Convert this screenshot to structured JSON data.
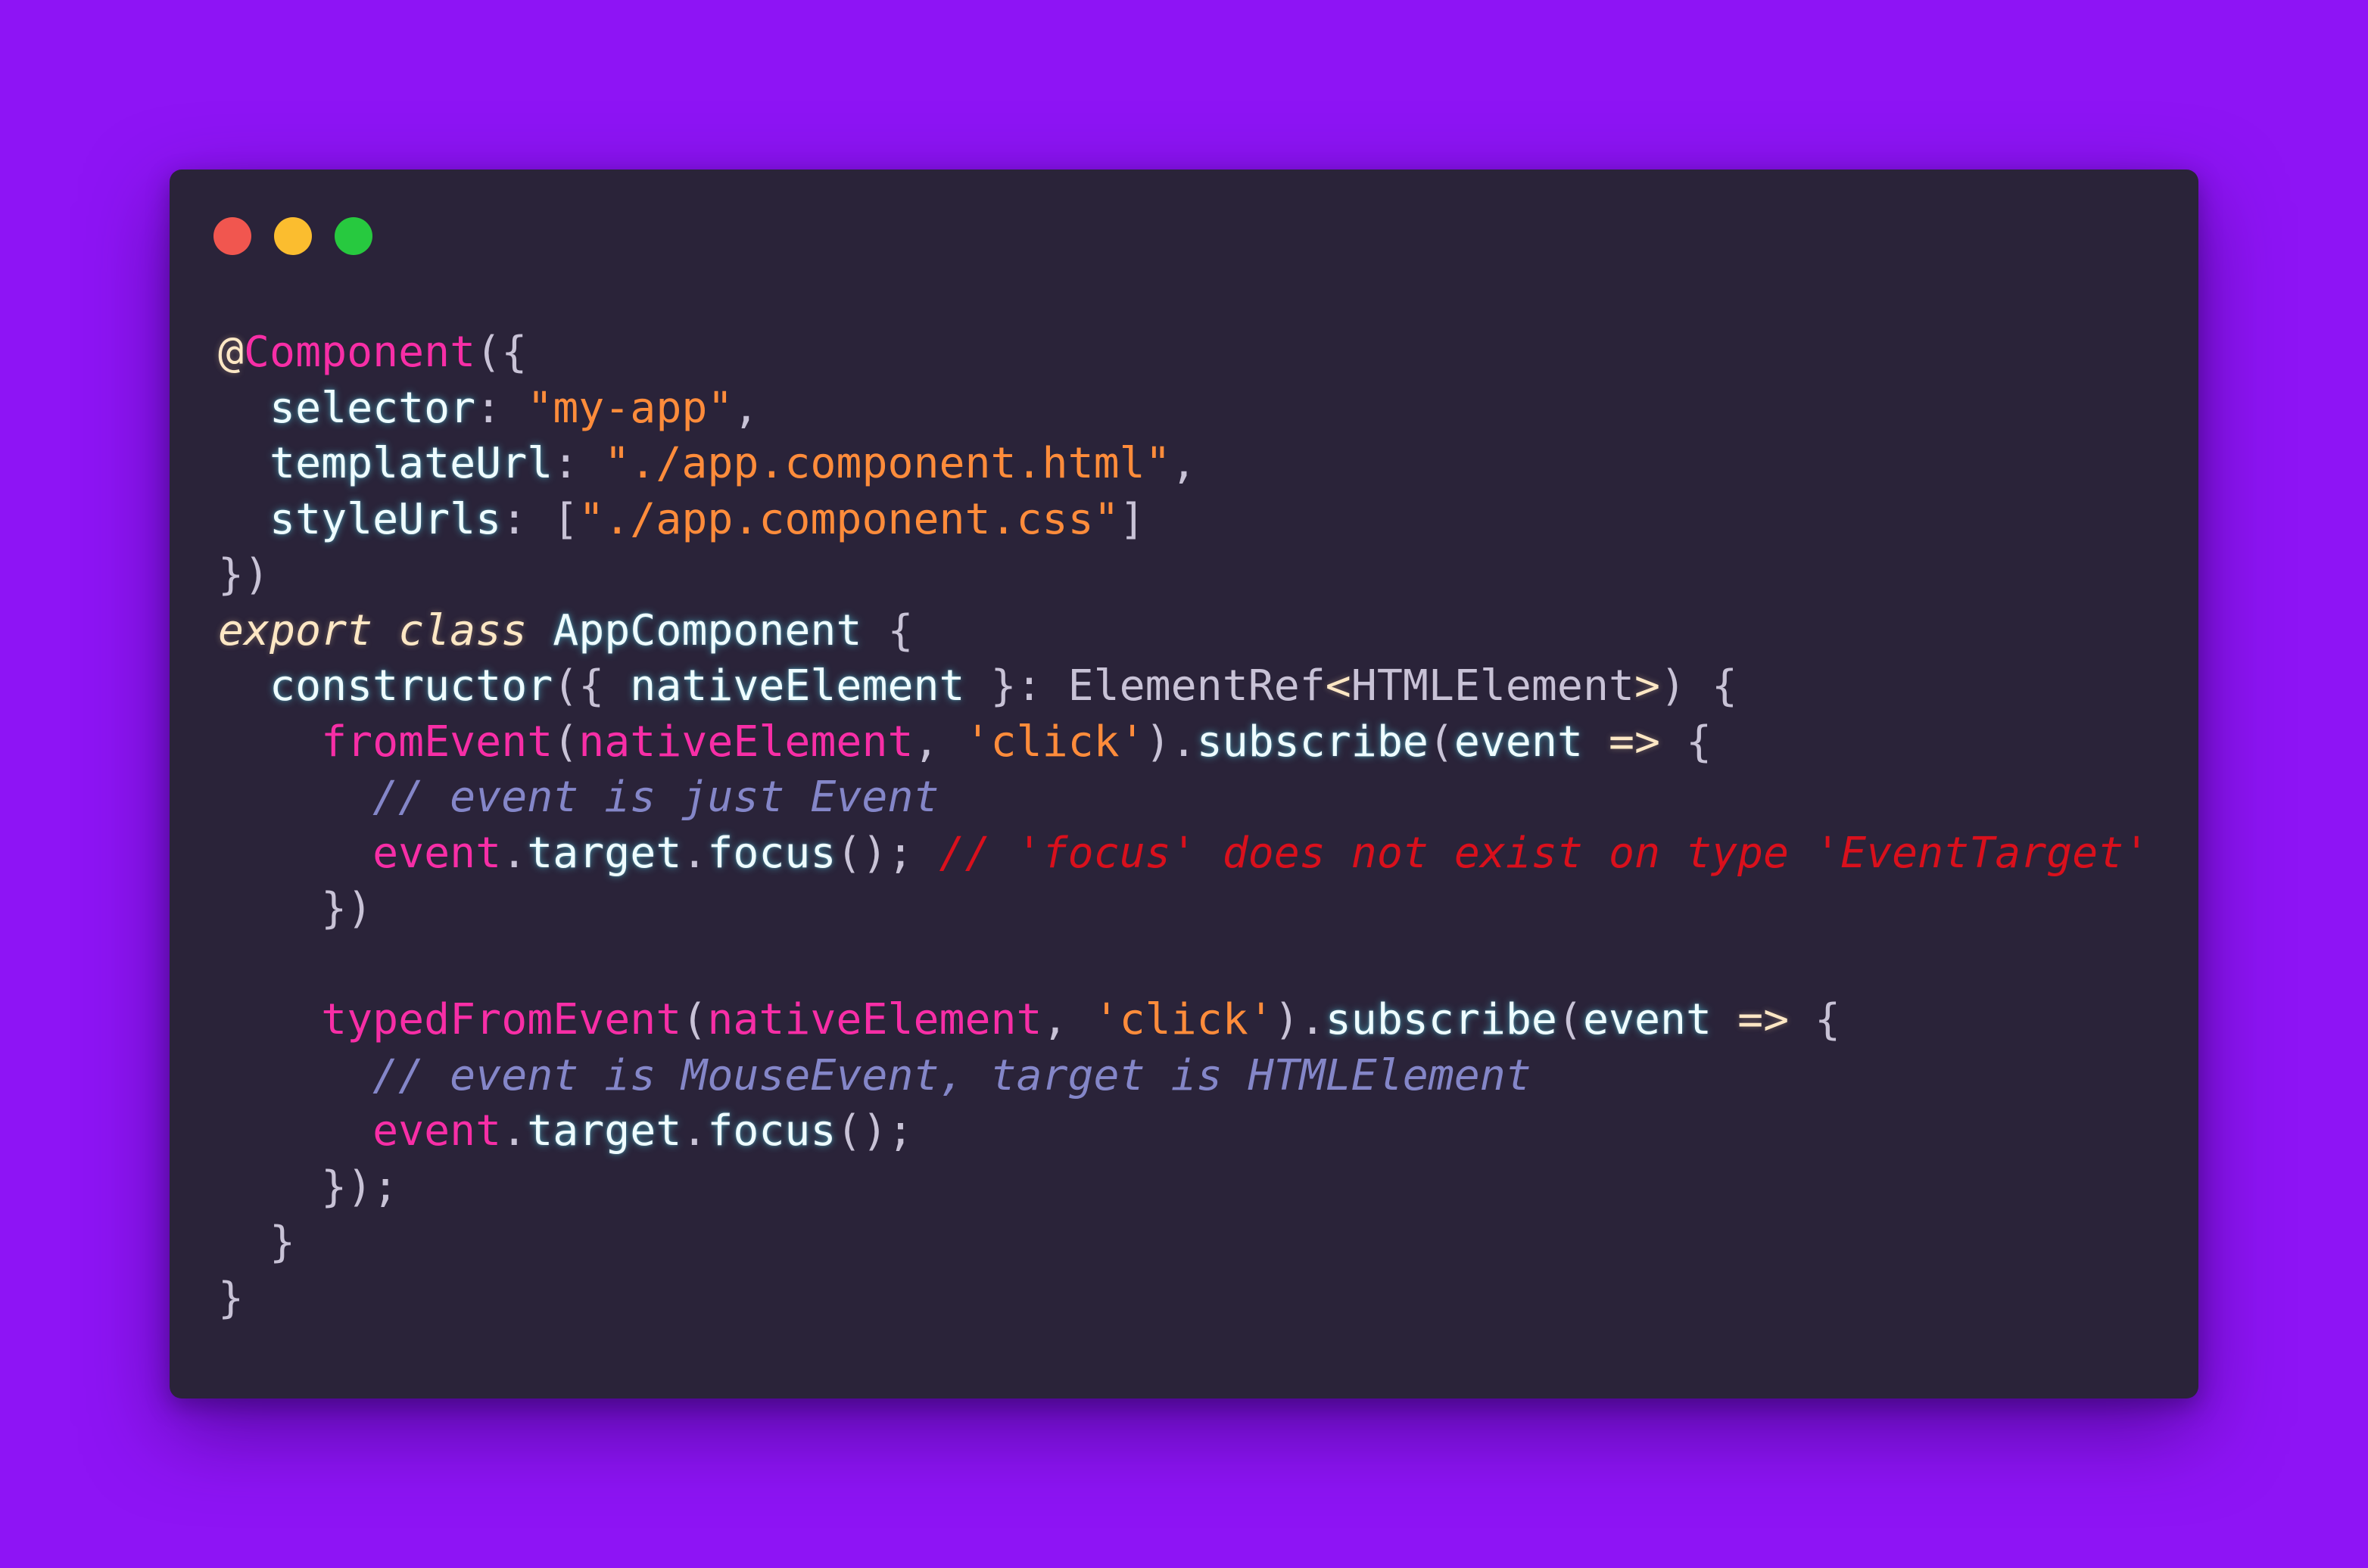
{
  "window": {
    "controls": [
      {
        "name": "close-button",
        "color": "#f1564f"
      },
      {
        "name": "minimize-button",
        "color": "#fbbd2f"
      },
      {
        "name": "maximize-button",
        "color": "#27c93f"
      }
    ]
  },
  "code_lines": [
    [
      {
        "t": "@",
        "s": "deco"
      },
      {
        "t": "Component",
        "s": "pink"
      },
      {
        "t": "({",
        "s": "punct"
      }
    ],
    [
      {
        "t": "  ",
        "s": "plain"
      },
      {
        "t": "selector",
        "s": "cyan"
      },
      {
        "t": ": ",
        "s": "punct"
      },
      {
        "t": "\"my-app\"",
        "s": "orange"
      },
      {
        "t": ",",
        "s": "punct"
      }
    ],
    [
      {
        "t": "  ",
        "s": "plain"
      },
      {
        "t": "templateUrl",
        "s": "cyan"
      },
      {
        "t": ": ",
        "s": "punct"
      },
      {
        "t": "\"./app.component.html\"",
        "s": "orange"
      },
      {
        "t": ",",
        "s": "punct"
      }
    ],
    [
      {
        "t": "  ",
        "s": "plain"
      },
      {
        "t": "styleUrls",
        "s": "cyan"
      },
      {
        "t": ": [",
        "s": "punct"
      },
      {
        "t": "\"./app.component.css\"",
        "s": "orange"
      },
      {
        "t": "]",
        "s": "punct"
      }
    ],
    [
      {
        "t": "})",
        "s": "punct"
      }
    ],
    [
      {
        "t": "export",
        "s": "keyword"
      },
      {
        "t": " ",
        "s": "plain"
      },
      {
        "t": "class",
        "s": "keyword"
      },
      {
        "t": " ",
        "s": "plain"
      },
      {
        "t": "AppComponent",
        "s": "cyan"
      },
      {
        "t": " {",
        "s": "punct"
      }
    ],
    [
      {
        "t": "  ",
        "s": "plain"
      },
      {
        "t": "constructor",
        "s": "cyan"
      },
      {
        "t": "({ ",
        "s": "punct"
      },
      {
        "t": "nativeElement",
        "s": "cyan"
      },
      {
        "t": " }: ",
        "s": "punct"
      },
      {
        "t": "ElementRef",
        "s": "type"
      },
      {
        "t": "<",
        "s": "operator"
      },
      {
        "t": "HTMLElement",
        "s": "type"
      },
      {
        "t": ">",
        "s": "operator"
      },
      {
        "t": ") {",
        "s": "punct"
      }
    ],
    [
      {
        "t": "    ",
        "s": "plain"
      },
      {
        "t": "fromEvent",
        "s": "pink"
      },
      {
        "t": "(",
        "s": "punct"
      },
      {
        "t": "nativeElement",
        "s": "pink"
      },
      {
        "t": ", ",
        "s": "punct"
      },
      {
        "t": "'click'",
        "s": "orange"
      },
      {
        "t": ").",
        "s": "punct"
      },
      {
        "t": "subscribe",
        "s": "cyan"
      },
      {
        "t": "(",
        "s": "punct"
      },
      {
        "t": "event",
        "s": "cyan"
      },
      {
        "t": " ",
        "s": "plain"
      },
      {
        "t": "=>",
        "s": "operator"
      },
      {
        "t": " {",
        "s": "punct"
      }
    ],
    [
      {
        "t": "      ",
        "s": "plain"
      },
      {
        "t": "// event is just Event",
        "s": "comment"
      }
    ],
    [
      {
        "t": "      ",
        "s": "plain"
      },
      {
        "t": "event",
        "s": "pink"
      },
      {
        "t": ".",
        "s": "punct"
      },
      {
        "t": "target",
        "s": "cyan"
      },
      {
        "t": ".",
        "s": "punct"
      },
      {
        "t": "focus",
        "s": "cyan"
      },
      {
        "t": "(); ",
        "s": "punct"
      },
      {
        "t": "// 'focus' does not exist on type 'EventTarget'",
        "s": "error"
      }
    ],
    [
      {
        "t": "    ",
        "s": "plain"
      },
      {
        "t": "})",
        "s": "punct"
      }
    ],
    [
      {
        "t": "",
        "s": "plain"
      }
    ],
    [
      {
        "t": "    ",
        "s": "plain"
      },
      {
        "t": "typedFromEvent",
        "s": "pink"
      },
      {
        "t": "(",
        "s": "punct"
      },
      {
        "t": "nativeElement",
        "s": "pink"
      },
      {
        "t": ", ",
        "s": "punct"
      },
      {
        "t": "'click'",
        "s": "orange"
      },
      {
        "t": ").",
        "s": "punct"
      },
      {
        "t": "subscribe",
        "s": "cyan"
      },
      {
        "t": "(",
        "s": "punct"
      },
      {
        "t": "event",
        "s": "cyan"
      },
      {
        "t": " ",
        "s": "plain"
      },
      {
        "t": "=>",
        "s": "operator"
      },
      {
        "t": " {",
        "s": "punct"
      }
    ],
    [
      {
        "t": "      ",
        "s": "plain"
      },
      {
        "t": "// event is MouseEvent, target is HTMLElement",
        "s": "comment"
      }
    ],
    [
      {
        "t": "      ",
        "s": "plain"
      },
      {
        "t": "event",
        "s": "pink"
      },
      {
        "t": ".",
        "s": "punct"
      },
      {
        "t": "target",
        "s": "cyan"
      },
      {
        "t": ".",
        "s": "punct"
      },
      {
        "t": "focus",
        "s": "cyan"
      },
      {
        "t": "();",
        "s": "punct"
      }
    ],
    [
      {
        "t": "    ",
        "s": "plain"
      },
      {
        "t": "});",
        "s": "punct"
      }
    ],
    [
      {
        "t": "  ",
        "s": "plain"
      },
      {
        "t": "}",
        "s": "punct"
      }
    ],
    [
      {
        "t": "}",
        "s": "punct"
      }
    ]
  ],
  "colors": {
    "background": "#8e14f5",
    "editor": "#2a2339",
    "pink": "#f72ea6",
    "cyan": "#eefcff",
    "orange": "#ff8c3b",
    "punct": "#c8c2d6",
    "type": "#c8c2d6",
    "keyword": "#fde7c4",
    "deco": "#fde7c4",
    "operator": "#fde7c4",
    "comment": "#8486c8",
    "error": "#d9101c",
    "plain": "#c8c2d6"
  }
}
